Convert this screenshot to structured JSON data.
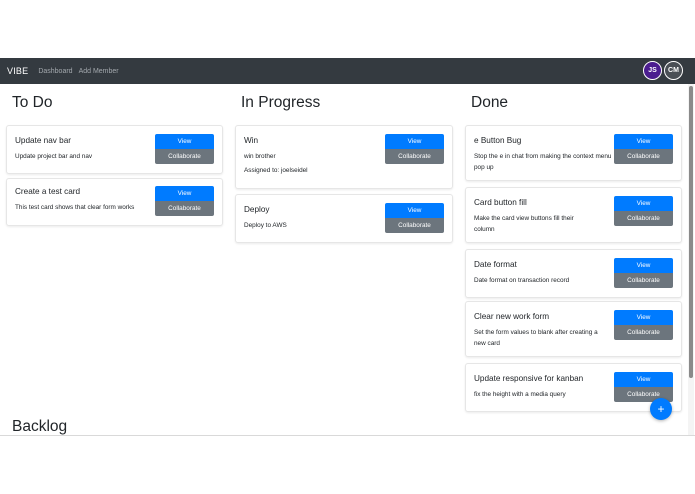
{
  "navbar": {
    "brand": "VIBE",
    "links": [
      "Dashboard",
      "Add Member"
    ],
    "avatars": [
      "JS",
      "CM"
    ],
    "colors": {
      "background": "#343a40",
      "avatar_js": "#4b1d8f",
      "avatar_cm": "#4a4f55"
    }
  },
  "columns": [
    {
      "title": "To Do",
      "cards": [
        {
          "title": "Update nav bar",
          "description": "Update project bar and nav"
        },
        {
          "title": "Create a test card",
          "description": "This test card shows that clear form works"
        }
      ]
    },
    {
      "title": "In Progress",
      "cards": [
        {
          "title": "Win",
          "description": "win brother",
          "assigned": "Assigned to: joelseidel"
        },
        {
          "title": "Deploy",
          "description": "Deploy to AWS"
        }
      ]
    },
    {
      "title": "Done",
      "cards": [
        {
          "title": "e Button Bug",
          "description": "Stop the e in chat from making the context menu pop up"
        },
        {
          "title": "Card button fill",
          "description": "Make the card view buttons fill their column"
        },
        {
          "title": "Date format",
          "description": "Date format on transaction record"
        },
        {
          "title": "Clear new work form",
          "description": "Set the form values to blank after creating a new card"
        },
        {
          "title": "Update responsive for kanban",
          "description": "fix the height with a media query"
        }
      ]
    }
  ],
  "buttons": {
    "view": "View",
    "collaborate": "Collaborate"
  },
  "backlog": {
    "title": "Backlog"
  },
  "fab": {
    "label": "+"
  },
  "colors": {
    "primary": "#007bff",
    "secondary": "#6c757d"
  }
}
